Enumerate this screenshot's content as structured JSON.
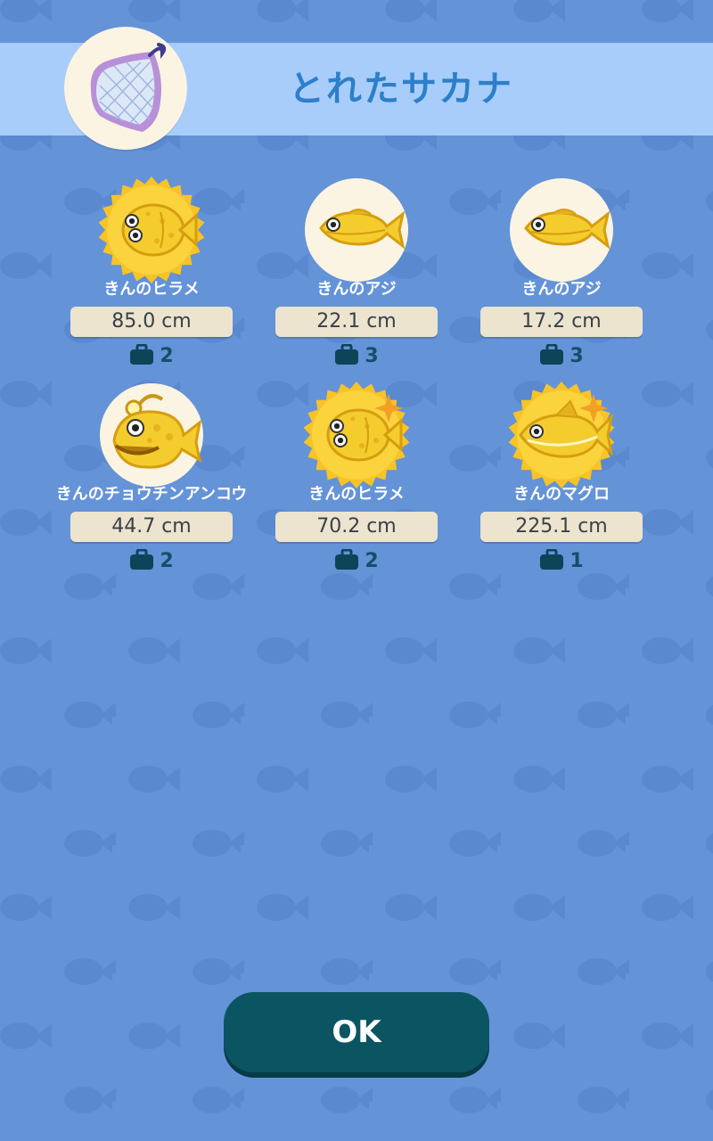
{
  "header": {
    "title": "とれたサカナ",
    "icon": "net-icon"
  },
  "fish": [
    {
      "name": "きんのヒラメ",
      "size": "85.0 cm",
      "count": "2",
      "kind": "flatfish",
      "frame": "burst"
    },
    {
      "name": "きんのアジ",
      "size": "22.1 cm",
      "count": "3",
      "kind": "horse-mackerel",
      "frame": "circle"
    },
    {
      "name": "きんのアジ",
      "size": "17.2 cm",
      "count": "3",
      "kind": "horse-mackerel",
      "frame": "circle"
    },
    {
      "name": "きんのチョウチンアンコウ",
      "size": "44.7 cm",
      "count": "2",
      "kind": "anglerfish",
      "frame": "circle"
    },
    {
      "name": "きんのヒラメ",
      "size": "70.2 cm",
      "count": "2",
      "kind": "flatfish",
      "frame": "burst"
    },
    {
      "name": "きんのマグロ",
      "size": "225.1 cm",
      "count": "1",
      "kind": "tuna",
      "frame": "burst"
    }
  ],
  "footer": {
    "ok_label": "OK"
  },
  "colors": {
    "background": "#6493d8",
    "header_band": "#a8cdfb",
    "title": "#2d7fc9",
    "gold": "#f7c326",
    "button": "#0b5563",
    "size_box": "#ece4cf"
  }
}
